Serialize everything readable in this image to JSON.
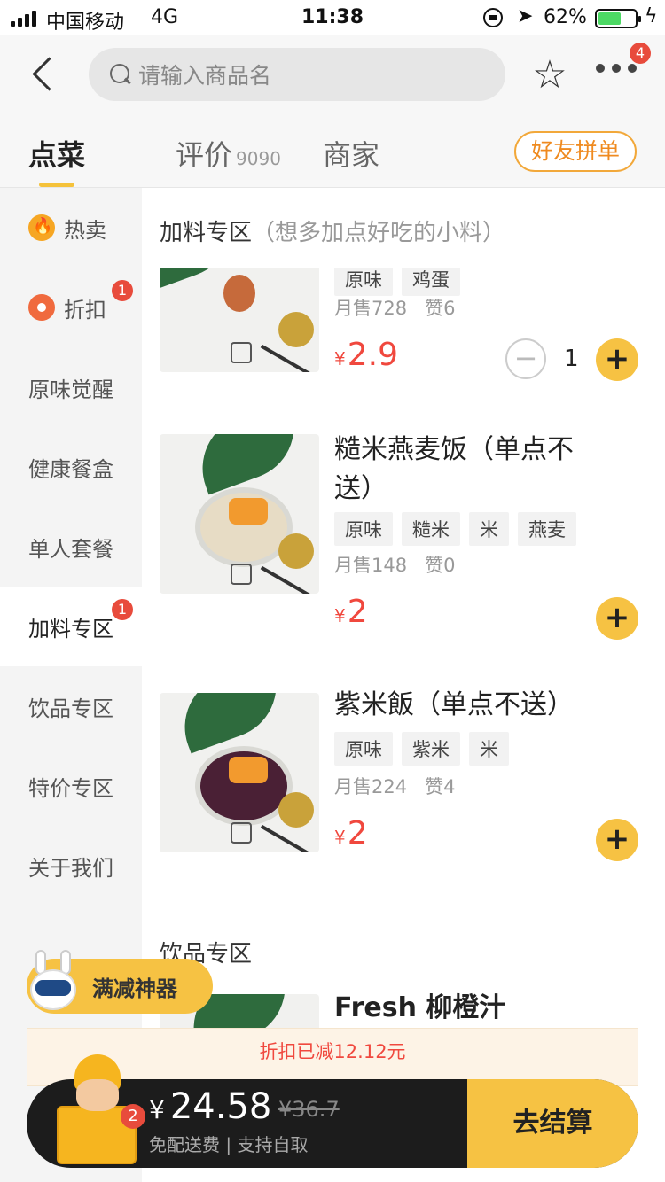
{
  "status_bar": {
    "carrier": "中国移动",
    "network": "4G",
    "time": "11:38",
    "battery": "62%",
    "battery_level": 0.62
  },
  "header": {
    "search_placeholder": "请输入商品名",
    "more_badge": "4"
  },
  "tabs": [
    {
      "label": "点菜",
      "count": ""
    },
    {
      "label": "评价",
      "count": "9090"
    },
    {
      "label": "商家",
      "count": ""
    }
  ],
  "friend_order_label": "好友拼单",
  "sidebar": {
    "items": [
      {
        "label": "热卖",
        "icon": "fire-icon",
        "badge": ""
      },
      {
        "label": "折扣",
        "icon": "discount-icon",
        "badge": "1"
      },
      {
        "label": "原味觉醒",
        "badge": ""
      },
      {
        "label": "健康餐盒",
        "badge": ""
      },
      {
        "label": "单人套餐",
        "badge": ""
      },
      {
        "label": "加料专区",
        "badge": "1",
        "active": true
      },
      {
        "label": "饮品专区",
        "badge": ""
      },
      {
        "label": "特价专区",
        "badge": ""
      },
      {
        "label": "关于我们",
        "badge": ""
      }
    ]
  },
  "sections": {
    "addons": {
      "title": "加料专区",
      "subtitle": "（想多加点好吃的小料）"
    },
    "drinks": {
      "title": "饮品专区"
    }
  },
  "items": [
    {
      "tags": [
        "原味",
        "鸡蛋"
      ],
      "monthly_sales": "月售728",
      "likes": "赞6",
      "currency": "¥",
      "price": "2.9",
      "quantity": "1"
    },
    {
      "name": "糙米燕麦饭（单点不送）",
      "tags": [
        "原味",
        "糙米",
        "米",
        "燕麦"
      ],
      "monthly_sales": "月售148",
      "likes": "赞0",
      "currency": "¥",
      "price": "2"
    },
    {
      "name": "紫米飯（单点不送）",
      "tags": [
        "原味",
        "紫米",
        "米"
      ],
      "monthly_sales": "月售224",
      "likes": "赞4",
      "currency": "¥",
      "price": "2"
    },
    {
      "name": "Fresh 柳橙汁"
    }
  ],
  "promo": {
    "label": "满减神器"
  },
  "discount_bar": {
    "text": "折扣已减12.12元"
  },
  "cart": {
    "currency": "¥",
    "total": "24.58",
    "original": "¥36.7",
    "note": "免配送费 | 支持自取",
    "badge": "2",
    "checkout_label": "去结算"
  },
  "colors": {
    "accent": "#f6c243",
    "price": "#f0483e",
    "badge": "#e84b3c"
  }
}
